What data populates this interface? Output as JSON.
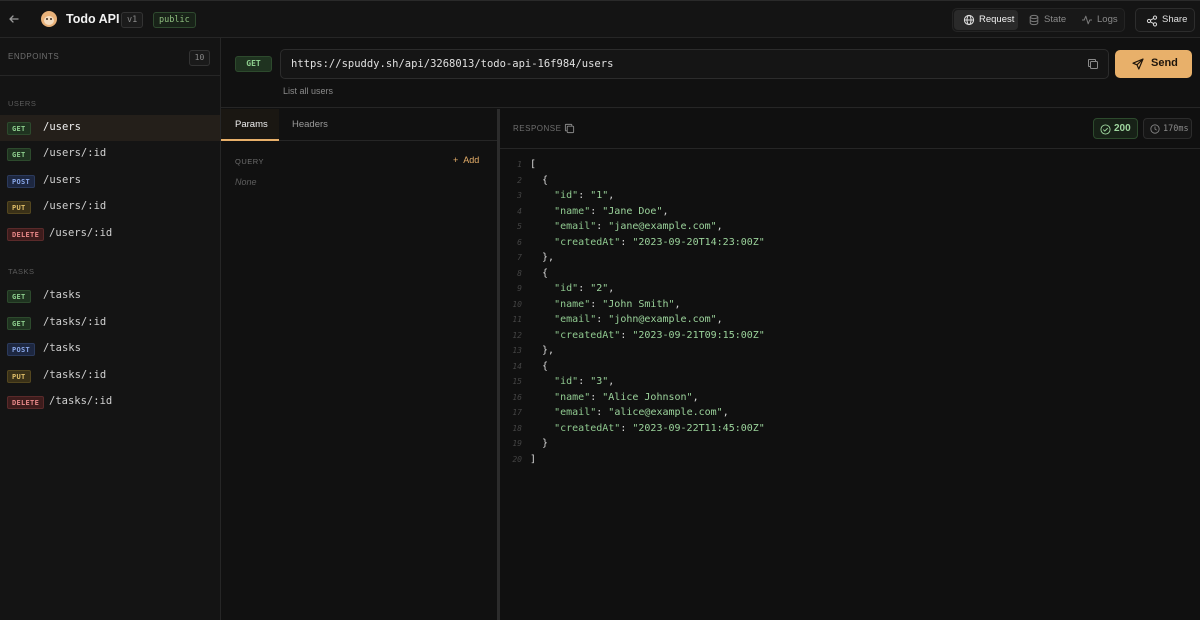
{
  "header": {
    "back_icon": "arrow-left-icon",
    "app_title": "Todo API",
    "version": "v1",
    "visibility": "public",
    "tabs": [
      {
        "label": "Request",
        "icon": "globe-icon",
        "active": true
      },
      {
        "label": "State",
        "icon": "database-icon",
        "active": false
      },
      {
        "label": "Logs",
        "icon": "activity-icon",
        "active": false
      }
    ],
    "share_label": "Share"
  },
  "sidebar": {
    "title": "ENDPOINTS",
    "count": "10",
    "groups": [
      {
        "label": "USERS",
        "endpoints": [
          {
            "method": "GET",
            "path": "/users",
            "active": true
          },
          {
            "method": "GET",
            "path": "/users/:id"
          },
          {
            "method": "POST",
            "path": "/users"
          },
          {
            "method": "PUT",
            "path": "/users/:id"
          },
          {
            "method": "DELETE",
            "path": "/users/:id"
          }
        ]
      },
      {
        "label": "TASKS",
        "endpoints": [
          {
            "method": "GET",
            "path": "/tasks"
          },
          {
            "method": "GET",
            "path": "/tasks/:id"
          },
          {
            "method": "POST",
            "path": "/tasks"
          },
          {
            "method": "PUT",
            "path": "/tasks/:id"
          },
          {
            "method": "DELETE",
            "path": "/tasks/:id"
          }
        ]
      }
    ]
  },
  "request": {
    "method": "GET",
    "url": "https://spuddy.sh/api/3268013/todo-api-16f984/users",
    "send_label": "Send",
    "description": "List all users"
  },
  "params": {
    "tabs": [
      "Params",
      "Headers"
    ],
    "query_label": "QUERY",
    "add_label": "Add",
    "empty_label": "None"
  },
  "response": {
    "label": "RESPONSE",
    "status": "200",
    "time": "170ms",
    "lines": [
      "[",
      "  {",
      "    \"id\": \"1\",",
      "    \"name\": \"Jane Doe\",",
      "    \"email\": \"jane@example.com\",",
      "    \"createdAt\": \"2023-09-20T14:23:00Z\"",
      "  },",
      "  {",
      "    \"id\": \"2\",",
      "    \"name\": \"John Smith\",",
      "    \"email\": \"john@example.com\",",
      "    \"createdAt\": \"2023-09-21T09:15:00Z\"",
      "  },",
      "  {",
      "    \"id\": \"3\",",
      "    \"name\": \"Alice Johnson\",",
      "    \"email\": \"alice@example.com\",",
      "    \"createdAt\": \"2023-09-22T11:45:00Z\"",
      "  }",
      "]"
    ]
  },
  "colors": {
    "accent": "#e8b06a",
    "get": "#8fd08f",
    "post": "#8aa8ea",
    "put": "#e2c06a",
    "delete": "#ea8a8a",
    "background": "#111111"
  }
}
